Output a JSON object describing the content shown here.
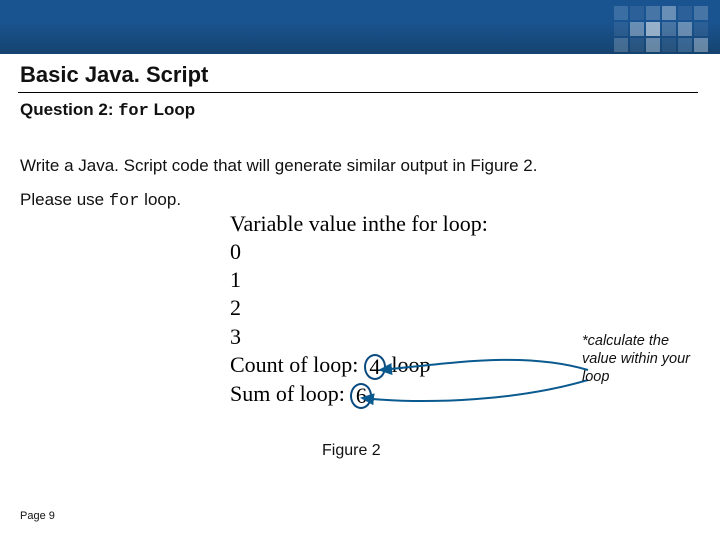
{
  "header": {
    "section_title": "Basic Java. Script"
  },
  "question": {
    "prefix": "Question 2: ",
    "code_kw": "for",
    "suffix": " Loop"
  },
  "instructions": {
    "line1": "Write a Java. Script code that will generate similar output in Figure 2.",
    "line2_prefix": "Please use ",
    "line2_code": "for",
    "line2_suffix": " loop."
  },
  "figure": {
    "title_line": "Variable value inthe for loop:",
    "values": [
      "0",
      "1",
      "2",
      "3"
    ],
    "count_label_pre": "Count of loop: ",
    "count_value": "4",
    "count_label_post": " loop",
    "sum_label_pre": "Sum of loop: ",
    "sum_value": "6",
    "caption": "Figure 2"
  },
  "annotation": {
    "text": "*calculate the value within your loop"
  },
  "footer": {
    "page_label": "Page 9"
  }
}
